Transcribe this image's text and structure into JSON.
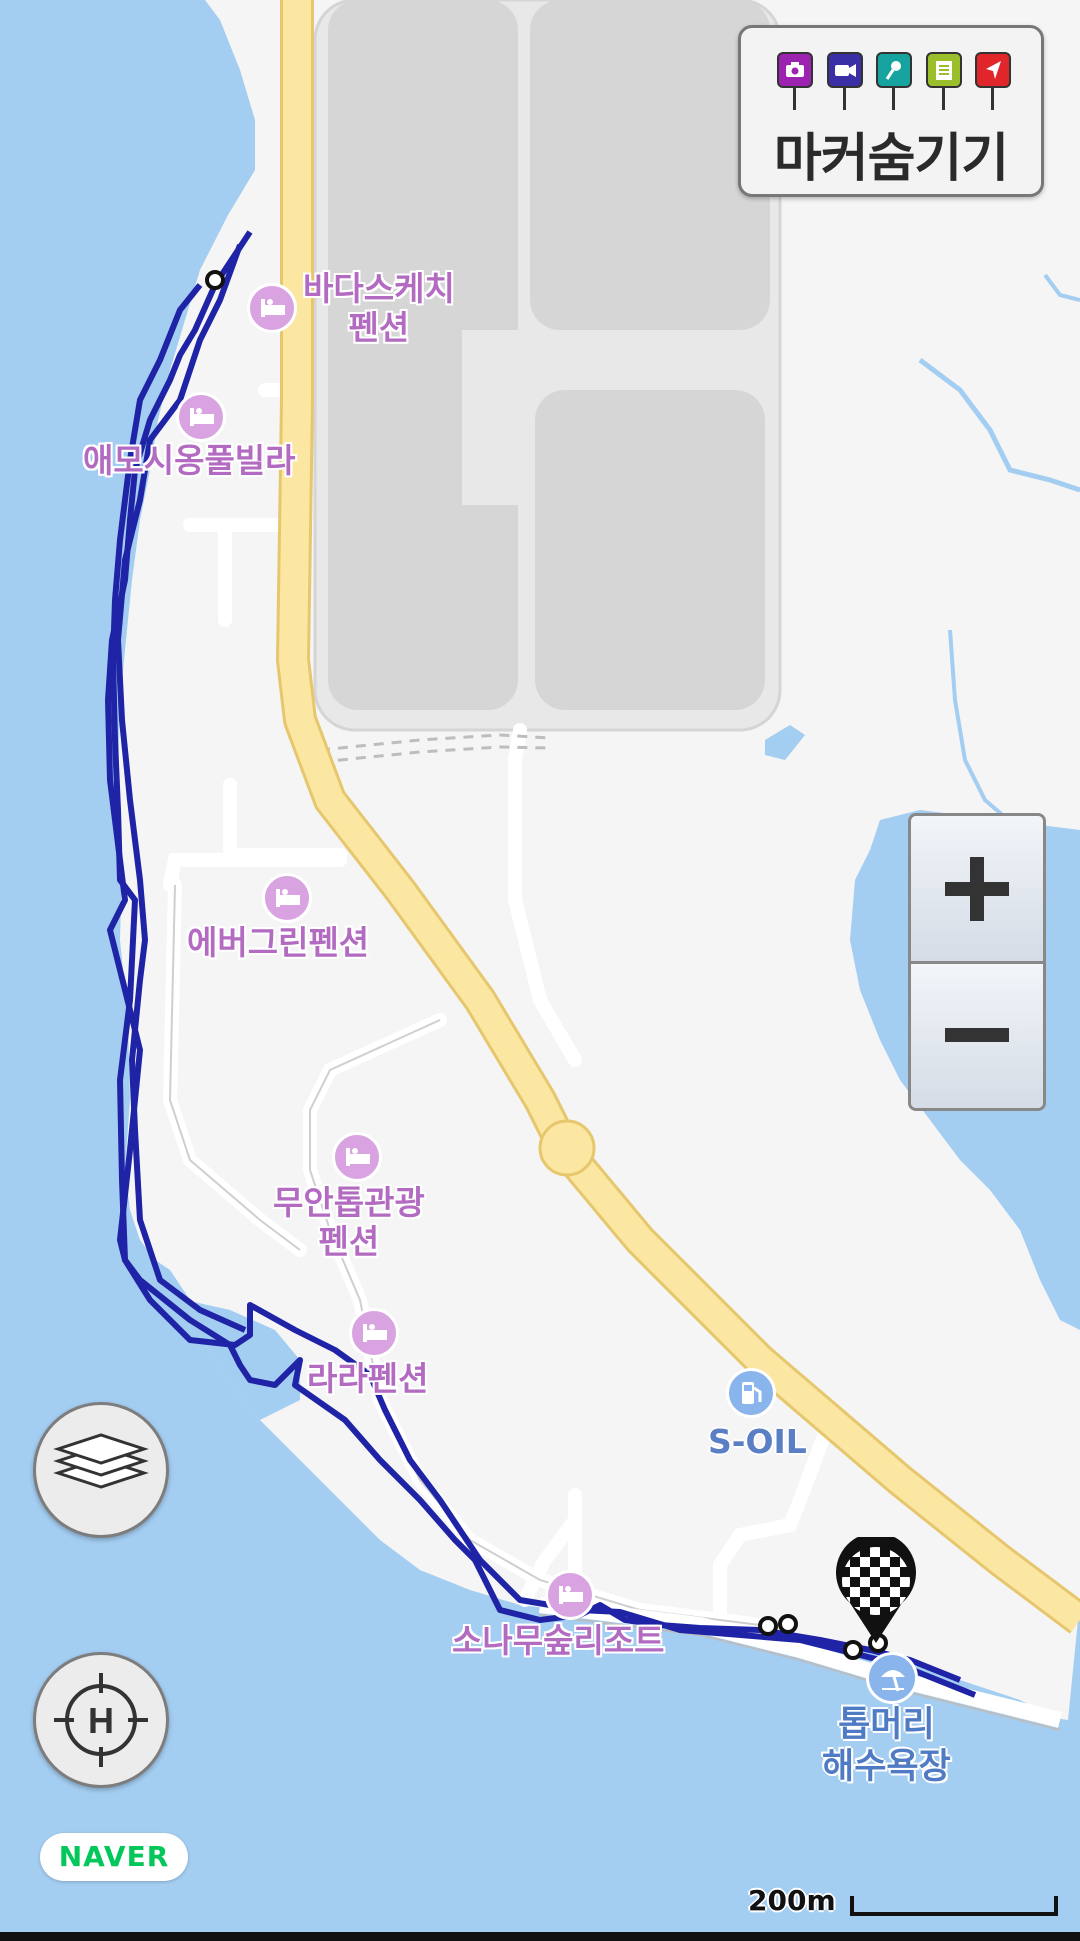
{
  "map": {
    "provider": "NAVER",
    "scale_label": "200m"
  },
  "marker_toggle": {
    "label": "마커숨기기",
    "icons": [
      {
        "name": "camera-icon",
        "color": "#9b23b0"
      },
      {
        "name": "video-icon",
        "color": "#3a2fa4"
      },
      {
        "name": "microphone-icon",
        "color": "#17a3a0"
      },
      {
        "name": "memo-icon",
        "color": "#9bbf2a"
      },
      {
        "name": "navigation-icon",
        "color": "#e0262b"
      }
    ]
  },
  "pois": [
    {
      "name": "바다스케치\n펜션",
      "type": "lodging"
    },
    {
      "name": "애모시옹풀빌라",
      "type": "lodging"
    },
    {
      "name": "에버그린펜션",
      "type": "lodging"
    },
    {
      "name": "무안톱관광\n펜션",
      "type": "lodging"
    },
    {
      "name": "라라펜션",
      "type": "lodging"
    },
    {
      "name": "소나무숲리조트",
      "type": "lodging"
    },
    {
      "name": "S-OIL",
      "type": "gas-station"
    },
    {
      "name": "톱머리\n해수욕장",
      "type": "beach"
    }
  ],
  "controls": {
    "zoom_in": "+",
    "zoom_out": "−"
  },
  "colors": {
    "sea": "#a3cdf1",
    "land": "#f5f5f5",
    "highway": "#fbe6a2",
    "track": "#1f23a6",
    "poi": "#b26bc1"
  }
}
